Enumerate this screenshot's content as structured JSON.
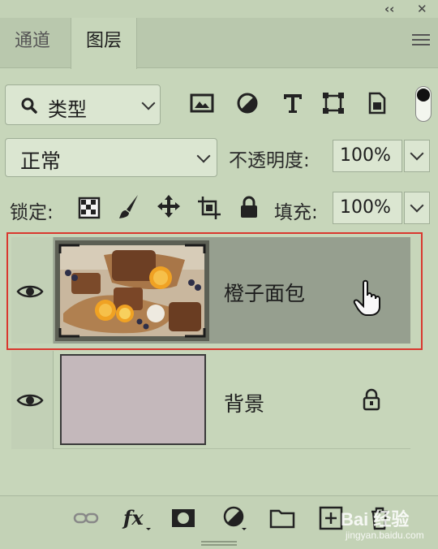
{
  "tabs": [
    {
      "label": "通道",
      "active": false
    },
    {
      "label": "图层",
      "active": true
    }
  ],
  "filter": {
    "selected": "类型"
  },
  "blend_mode": {
    "selected": "正常"
  },
  "opacity": {
    "label": "不透明度:",
    "value": "100%"
  },
  "lock": {
    "label": "锁定:"
  },
  "fill": {
    "label": "填充:",
    "value": "100%"
  },
  "layers": [
    {
      "name": "橙子面包",
      "visible": true,
      "selected": true,
      "locked": false
    },
    {
      "name": "背景",
      "visible": true,
      "selected": false,
      "locked": true
    }
  ],
  "bottom_icons": [
    "link-icon",
    "fx-icon",
    "mask-icon",
    "adjustment-icon",
    "folder-icon",
    "new-layer-icon",
    "delete-icon"
  ],
  "colors": {
    "panel_bg": "#c7d6ba",
    "selected_row": "#969f8f",
    "highlight_outline": "#d9382f",
    "background_swatch": "#c4b8bb"
  },
  "watermark": {
    "brand": "Bai 经验",
    "url": "jingyan.baidu.com"
  }
}
